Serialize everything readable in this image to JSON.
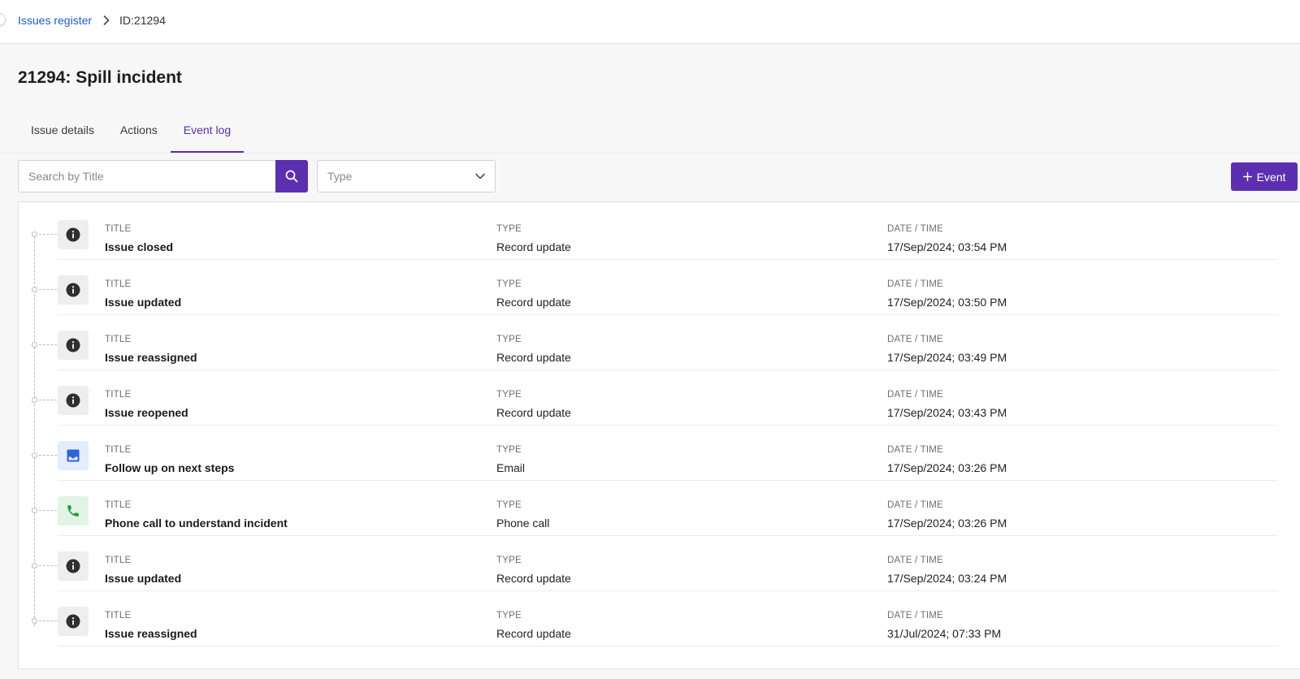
{
  "breadcrumb": {
    "parent": "Issues register",
    "current": "ID:21294"
  },
  "page": {
    "title": "21294: Spill incident"
  },
  "tabs": [
    {
      "label": "Issue details",
      "active": false
    },
    {
      "label": "Actions",
      "active": false
    },
    {
      "label": "Event log",
      "active": true
    }
  ],
  "toolbar": {
    "search_placeholder": "Search by Title",
    "type_placeholder": "Type",
    "add_event_label": "Event"
  },
  "columns": {
    "title": "TITLE",
    "type": "TYPE",
    "datetime": "DATE / TIME"
  },
  "events": [
    {
      "icon": "info-icon",
      "title": "Issue closed",
      "type": "Record update",
      "datetime": "17/Sep/2024; 03:54 PM"
    },
    {
      "icon": "info-icon",
      "title": "Issue updated",
      "type": "Record update",
      "datetime": "17/Sep/2024; 03:50 PM"
    },
    {
      "icon": "info-icon",
      "title": "Issue reassigned",
      "type": "Record update",
      "datetime": "17/Sep/2024; 03:49 PM"
    },
    {
      "icon": "info-icon",
      "title": "Issue reopened",
      "type": "Record update",
      "datetime": "17/Sep/2024; 03:43 PM"
    },
    {
      "icon": "inbox-icon",
      "title": "Follow up on next steps",
      "type": "Email",
      "datetime": "17/Sep/2024; 03:26 PM"
    },
    {
      "icon": "phone-icon",
      "title": "Phone call to understand incident",
      "type": "Phone call",
      "datetime": "17/Sep/2024; 03:26 PM"
    },
    {
      "icon": "info-icon",
      "title": "Issue updated",
      "type": "Record update",
      "datetime": "17/Sep/2024; 03:24 PM"
    },
    {
      "icon": "info-icon",
      "title": "Issue reassigned",
      "type": "Record update",
      "datetime": "31/Jul/2024; 07:33 PM"
    }
  ],
  "colors": {
    "accent": "#5b2fb0",
    "link": "#2159c8",
    "email_icon": "#2a66d6",
    "phone_icon": "#1f9a3c",
    "info_icon": "#2f2f2f"
  }
}
